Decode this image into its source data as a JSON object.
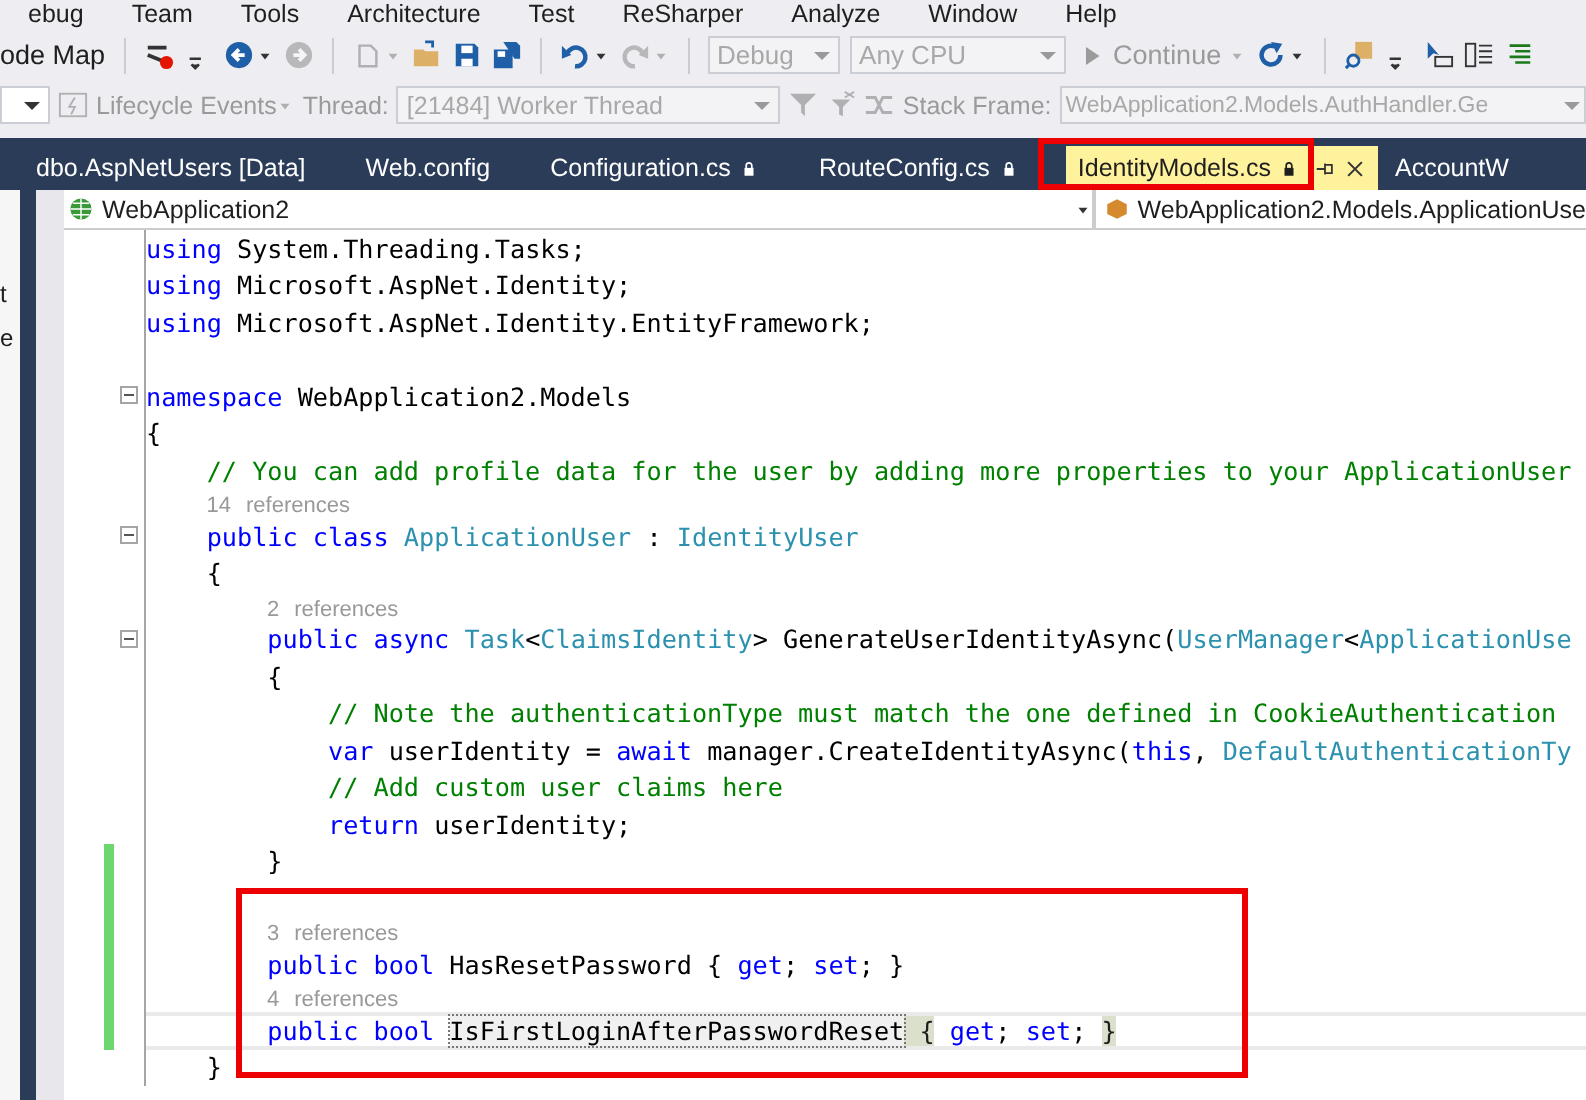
{
  "menu_bar": {
    "items": [
      "ebug",
      "Team",
      "Tools",
      "Architecture",
      "Test",
      "ReSharper",
      "Analyze",
      "Window",
      "Help"
    ]
  },
  "toolbar_1": [
    {
      "kind": "text",
      "label": "ode Map",
      "disabled": false
    },
    {
      "kind": "sep"
    },
    {
      "kind": "icon",
      "disabled": false
    },
    {
      "kind": "icon",
      "disabled": false
    },
    {
      "kind": "icon",
      "disabled": false
    },
    {
      "kind": "caret",
      "disabled": false
    },
    {
      "kind": "icon",
      "disabled": true
    },
    {
      "kind": "sep"
    },
    {
      "kind": "icon",
      "disabled": true
    },
    {
      "kind": "caret",
      "disabled": true
    },
    {
      "kind": "icon",
      "disabled": false
    },
    {
      "kind": "icon",
      "disabled": false
    },
    {
      "kind": "icon",
      "disabled": false
    },
    {
      "kind": "sep"
    },
    {
      "kind": "icon",
      "disabled": false
    },
    {
      "kind": "caret",
      "disabled": false
    },
    {
      "kind": "icon",
      "disabled": true
    },
    {
      "kind": "caret",
      "disabled": true
    },
    {
      "kind": "sep"
    },
    {
      "kind": "dropdown",
      "label": "Debug",
      "disabled": true
    },
    {
      "kind": "dropdown",
      "label": "Any CPU",
      "disabled": true
    },
    {
      "kind": "button",
      "label": "Continue",
      "disabled": true
    },
    {
      "kind": "caret",
      "disabled": true
    },
    {
      "kind": "icon",
      "disabled": false
    },
    {
      "kind": "caret",
      "disabled": false
    },
    {
      "kind": "sep"
    },
    {
      "kind": "icon",
      "disabled": false
    },
    {
      "kind": "icon",
      "disabled": false
    },
    {
      "kind": "icon",
      "disabled": false
    },
    {
      "kind": "icon",
      "disabled": false
    },
    {
      "kind": "icon",
      "disabled": false
    }
  ],
  "toolbar_2": [
    {
      "kind": "dropdown",
      "disabled": false
    },
    {
      "kind": "icon",
      "disabled": true
    },
    {
      "kind": "text",
      "label": "Lifecycle Events",
      "disabled": true
    },
    {
      "kind": "caret",
      "disabled": true
    },
    {
      "kind": "text",
      "label": "Thread:",
      "disabled": true
    },
    {
      "kind": "dropdown",
      "label": "[21484] Worker Thread",
      "disabled": true
    },
    {
      "kind": "icon",
      "disabled": true
    },
    {
      "kind": "icon",
      "disabled": true
    },
    {
      "kind": "icon",
      "disabled": true
    },
    {
      "kind": "text",
      "label": "Stack Frame:",
      "disabled": true
    },
    {
      "kind": "dropdown",
      "label": "WebApplication2.Models.AuthHandler.Ge",
      "disabled": true
    }
  ],
  "tabs": [
    {
      "label": "dbo.AspNetUsers [Data]",
      "selected": false,
      "locked": false,
      "boxed": false
    },
    {
      "label": "Web.config",
      "selected": false,
      "locked": false,
      "boxed": false
    },
    {
      "label": "Configuration.cs",
      "selected": false,
      "locked": true,
      "boxed": false
    },
    {
      "label": "RouteConfig.cs",
      "selected": false,
      "locked": true,
      "boxed": false
    },
    {
      "label": "IdentityModels.cs",
      "selected": true,
      "locked": true,
      "boxed": true
    },
    {
      "label": "AccountW",
      "selected": false,
      "locked": false,
      "boxed": false
    }
  ],
  "navigation_bar": {
    "project": "WebApplication2",
    "member": "WebApplication2.Models.ApplicationUse"
  },
  "side_panel": {
    "texts": [
      "t",
      "e"
    ]
  },
  "code_lines": [
    {
      "kind": "code",
      "fold": false,
      "changed": false,
      "current": false,
      "boxed": false,
      "tokens": [
        {
          "kind": "kw",
          "text": "using"
        },
        {
          "kind": "plain",
          "text": " System.Threading.Tasks;"
        }
      ]
    },
    {
      "kind": "code",
      "fold": false,
      "changed": false,
      "current": false,
      "boxed": false,
      "tokens": [
        {
          "kind": "kw",
          "text": "using"
        },
        {
          "kind": "plain",
          "text": " Microsoft.AspNet.Identity;"
        }
      ]
    },
    {
      "kind": "code",
      "fold": false,
      "changed": false,
      "current": false,
      "boxed": false,
      "tokens": [
        {
          "kind": "kw",
          "text": "using"
        },
        {
          "kind": "plain",
          "text": " Microsoft.AspNet.Identity.EntityFramework;"
        }
      ]
    },
    {
      "kind": "blank"
    },
    {
      "kind": "code",
      "fold": true,
      "changed": false,
      "current": false,
      "boxed": false,
      "tokens": [
        {
          "kind": "kw",
          "text": "namespace"
        },
        {
          "kind": "plain",
          "text": " WebApplication2.Models"
        }
      ]
    },
    {
      "kind": "code",
      "fold": false,
      "changed": false,
      "current": false,
      "boxed": false,
      "tokens": [
        {
          "kind": "plain",
          "text": "{"
        }
      ]
    },
    {
      "kind": "code",
      "fold": false,
      "changed": false,
      "current": false,
      "boxed": false,
      "tokens": [
        {
          "kind": "com",
          "text": "    // You can add profile data for the user by adding more properties to your ApplicationUser"
        }
      ]
    },
    {
      "kind": "lens",
      "fold": false,
      "changed": false,
      "current": false,
      "boxed": false,
      "tokens": [
        {
          "kind": "lens",
          "text": "    14 references"
        }
      ]
    },
    {
      "kind": "code",
      "fold": true,
      "changed": false,
      "current": false,
      "boxed": false,
      "tokens": [
        {
          "kind": "kw",
          "text": "    public class"
        },
        {
          "kind": "type",
          "text": " ApplicationUser"
        },
        {
          "kind": "plain",
          "text": " : "
        },
        {
          "kind": "type",
          "text": "IdentityUser"
        }
      ]
    },
    {
      "kind": "code",
      "fold": false,
      "changed": false,
      "current": false,
      "boxed": false,
      "tokens": [
        {
          "kind": "plain",
          "text": "    {"
        }
      ]
    },
    {
      "kind": "lens",
      "fold": false,
      "changed": false,
      "current": false,
      "boxed": false,
      "tokens": [
        {
          "kind": "lens",
          "text": "        2 references"
        }
      ]
    },
    {
      "kind": "code",
      "fold": true,
      "changed": false,
      "current": false,
      "boxed": false,
      "tokens": [
        {
          "kind": "kw",
          "text": "        public async"
        },
        {
          "kind": "type",
          "text": " Task"
        },
        {
          "kind": "plain",
          "text": "<"
        },
        {
          "kind": "type",
          "text": "ClaimsIdentity"
        },
        {
          "kind": "plain",
          "text": "> GenerateUserIdentityAsync("
        },
        {
          "kind": "type",
          "text": "UserManager"
        },
        {
          "kind": "plain",
          "text": "<"
        },
        {
          "kind": "type",
          "text": "ApplicationUse"
        }
      ]
    },
    {
      "kind": "code",
      "fold": false,
      "changed": false,
      "current": false,
      "boxed": false,
      "tokens": [
        {
          "kind": "plain",
          "text": "        {"
        }
      ]
    },
    {
      "kind": "code",
      "fold": false,
      "changed": false,
      "current": false,
      "boxed": false,
      "tokens": [
        {
          "kind": "com",
          "text": "            // Note the authenticationType must match the one defined in CookieAuthentication"
        }
      ]
    },
    {
      "kind": "code",
      "fold": false,
      "changed": false,
      "current": false,
      "boxed": false,
      "tokens": [
        {
          "kind": "kw",
          "text": "            var"
        },
        {
          "kind": "plain",
          "text": " userIdentity = "
        },
        {
          "kind": "kw",
          "text": "await"
        },
        {
          "kind": "plain",
          "text": " manager.CreateIdentityAsync("
        },
        {
          "kind": "kw",
          "text": "this"
        },
        {
          "kind": "plain",
          "text": ", "
        },
        {
          "kind": "type",
          "text": "DefaultAuthenticationTy"
        }
      ]
    },
    {
      "kind": "code",
      "fold": false,
      "changed": false,
      "current": false,
      "boxed": false,
      "tokens": [
        {
          "kind": "com",
          "text": "            // Add custom user claims here"
        }
      ]
    },
    {
      "kind": "code",
      "fold": false,
      "changed": false,
      "current": false,
      "boxed": false,
      "tokens": [
        {
          "kind": "kw",
          "text": "            return"
        },
        {
          "kind": "plain",
          "text": " userIdentity;"
        }
      ]
    },
    {
      "kind": "code",
      "fold": false,
      "changed": true,
      "current": false,
      "boxed": false,
      "tokens": [
        {
          "kind": "plain",
          "text": "        }"
        }
      ]
    },
    {
      "kind": "blank",
      "changed": true
    },
    {
      "kind": "lens",
      "fold": false,
      "changed": true,
      "current": false,
      "boxed": true,
      "tokens": [
        {
          "kind": "lens",
          "text": "        3 references"
        }
      ]
    },
    {
      "kind": "code",
      "fold": false,
      "changed": true,
      "current": false,
      "boxed": true,
      "tokens": [
        {
          "kind": "kw",
          "text": "        public bool"
        },
        {
          "kind": "plain",
          "text": " HasResetPassword { "
        },
        {
          "kind": "kw",
          "text": "get"
        },
        {
          "kind": "plain",
          "text": "; "
        },
        {
          "kind": "kw",
          "text": "set"
        },
        {
          "kind": "plain",
          "text": "; }"
        }
      ]
    },
    {
      "kind": "lens",
      "fold": false,
      "changed": true,
      "current": false,
      "boxed": true,
      "tokens": [
        {
          "kind": "lens",
          "text": "        4 references"
        }
      ]
    },
    {
      "kind": "code",
      "fold": false,
      "changed": true,
      "current": true,
      "boxed": true,
      "tokens": [
        {
          "kind": "kw",
          "text": "        public bool "
        },
        {
          "kind": "rename",
          "text": "IsFirstLoginAfterPasswordReset"
        },
        {
          "kind": "brace",
          "text": " {"
        },
        {
          "kind": "kw",
          "text": " get"
        },
        {
          "kind": "plain",
          "text": ";"
        },
        {
          "kind": "kw",
          "text": " set"
        },
        {
          "kind": "plain",
          "text": "; "
        },
        {
          "kind": "brace",
          "text": "}"
        }
      ]
    },
    {
      "kind": "code",
      "fold": false,
      "changed": false,
      "current": false,
      "boxed": false,
      "tokens": [
        {
          "kind": "plain",
          "text": "    }"
        }
      ]
    }
  ]
}
